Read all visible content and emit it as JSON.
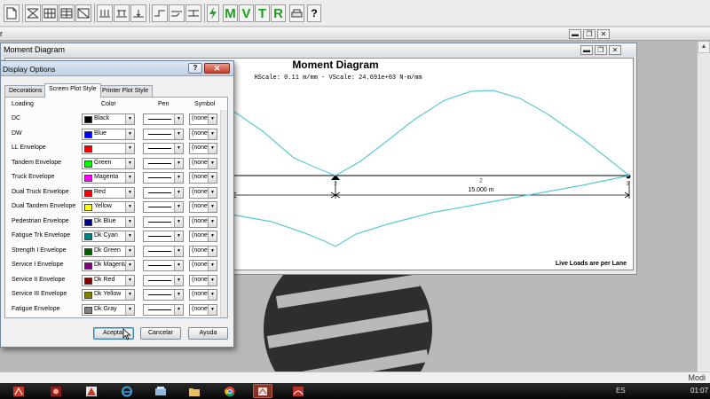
{
  "toolbar": {
    "letters": [
      "M",
      "V",
      "T",
      "R"
    ],
    "help_label": "?"
  },
  "outer_window": {
    "title_fragment": "r",
    "buttons": {
      "minimize": "▬",
      "restore": "❐",
      "close": "✕"
    }
  },
  "moment_window": {
    "title": "Moment Diagram",
    "chart_title": "Moment Diagram",
    "scale_text": "HScale: 0.11 m/mm - VScale: 24.691e+03 N-m/mm",
    "span_label": "2",
    "support_label_mid": "2",
    "support_label_right": "3",
    "span_length": "15.000 m",
    "note": "Live Loads are per Lane",
    "buttons": {
      "minimize": "▬",
      "restore": "❐",
      "close": "✕"
    }
  },
  "dialog": {
    "title": "Display Options",
    "help": "?",
    "close": "✕",
    "tabs": [
      {
        "label": "Decorations",
        "active": false
      },
      {
        "label": "Screen Plot Style",
        "active": true
      },
      {
        "label": "Printer Plot Style",
        "active": false
      }
    ],
    "columns": {
      "loading": "Loading",
      "color": "Color",
      "pen": "Pen",
      "symbol": "Symbol"
    },
    "rows": [
      {
        "loading": "DC",
        "color": "Black",
        "swatch": "#000000",
        "symbol": "(none)"
      },
      {
        "loading": "DW",
        "color": "Blue",
        "swatch": "#0000ff",
        "symbol": "(none)"
      },
      {
        "loading": "LL Envelope",
        "color": "",
        "swatch": "#ff0000",
        "symbol": "(none)"
      },
      {
        "loading": "Tandem Envelope",
        "color": "Green",
        "swatch": "#00ff00",
        "symbol": "(none)"
      },
      {
        "loading": "Truck Envelope",
        "color": "Magenta",
        "swatch": "#ff00ff",
        "symbol": "(none)"
      },
      {
        "loading": "Dual Truck Envelope",
        "color": "Red",
        "swatch": "#ff0000",
        "symbol": "(none)"
      },
      {
        "loading": "Dual Tandem Envelope",
        "color": "Yellow",
        "swatch": "#ffff00",
        "symbol": "(none)"
      },
      {
        "loading": "Pedestrian Envelope",
        "color": "Dk Blue",
        "swatch": "#000080",
        "symbol": "(none)"
      },
      {
        "loading": "Fatigue Trk Envelope",
        "color": "Dk Cyan",
        "swatch": "#008080",
        "symbol": "(none)"
      },
      {
        "loading": "Strength I Envelope",
        "color": "Dk Green",
        "swatch": "#006000",
        "symbol": "(none)"
      },
      {
        "loading": "Service I Envelope",
        "color": "Dk Magenta",
        "swatch": "#800080",
        "symbol": "(none)"
      },
      {
        "loading": "Service II Envelope",
        "color": "Dk Red",
        "swatch": "#800000",
        "symbol": "(none)"
      },
      {
        "loading": "Service III Envelope",
        "color": "Dk Yellow",
        "swatch": "#808000",
        "symbol": "(none)"
      },
      {
        "loading": "Fatigue Envelope",
        "color": "Dk Gray",
        "swatch": "#808080",
        "symbol": "(none)"
      }
    ],
    "buttons": {
      "accept": "Aceptar",
      "cancel": "Cancelar",
      "help": "Ayuda"
    }
  },
  "status_bar": {
    "right_text": "Modi"
  },
  "taskbar": {
    "language": "ES",
    "clock": "01:07"
  },
  "colors": {
    "curve": "#5bc8d8",
    "dialog_title": "#c9d8ea",
    "close_red": "#c94a35"
  }
}
